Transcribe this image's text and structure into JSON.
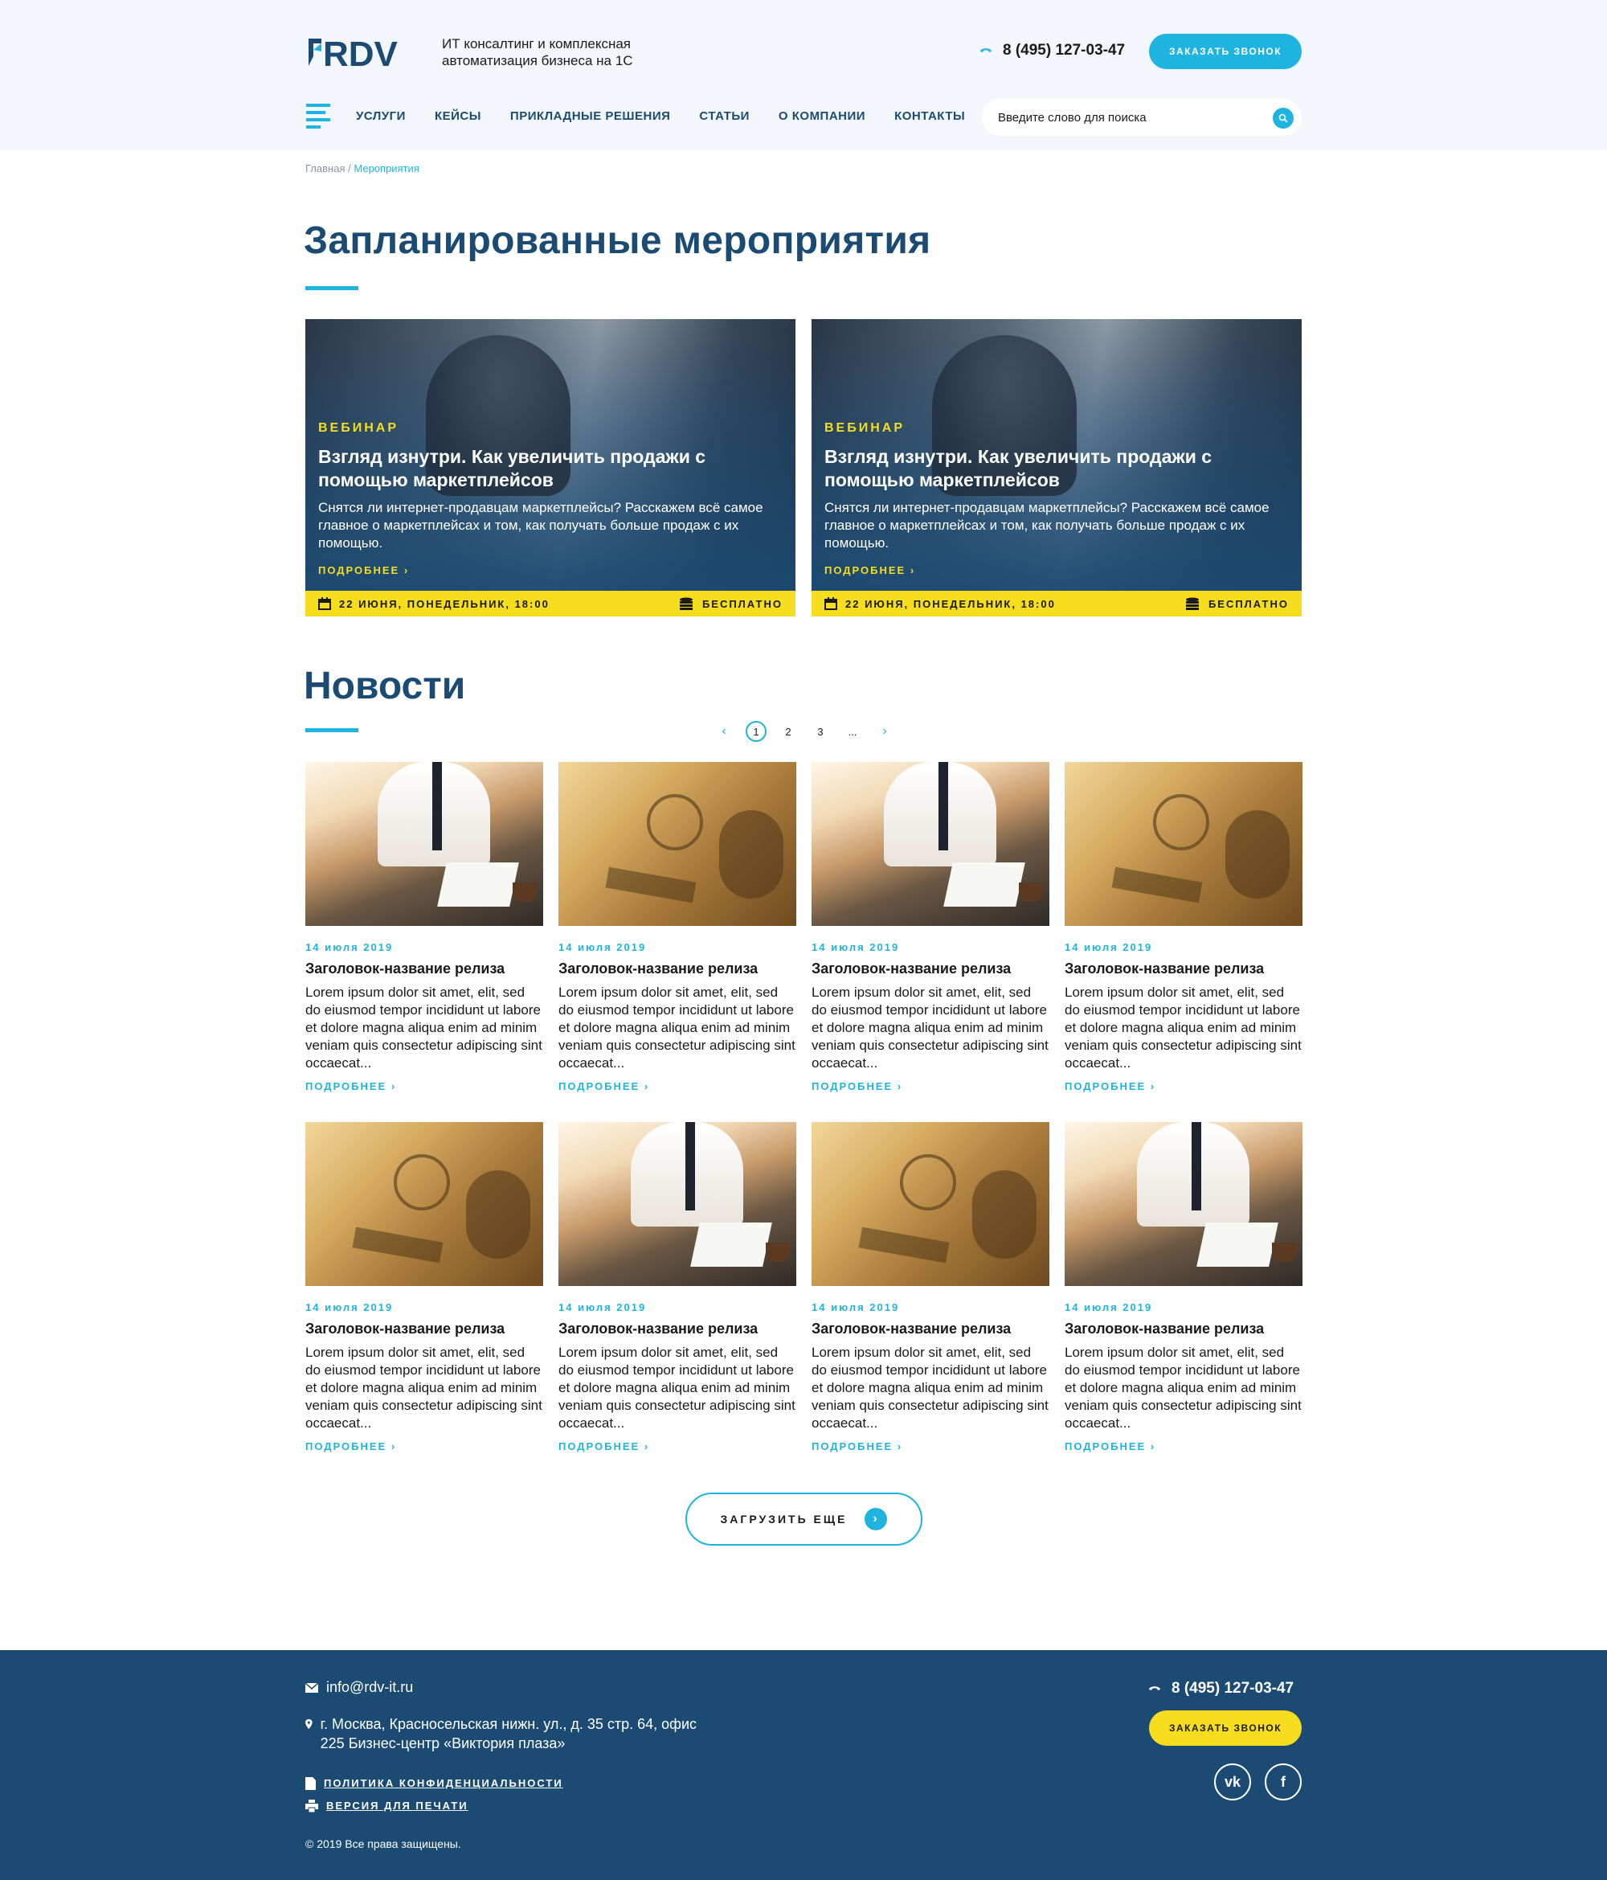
{
  "header": {
    "logo_text": "RDV",
    "tagline": "ИТ консалтинг и комплексная автоматизация бизнеса на 1С",
    "phone": "8 (495) 127-03-47",
    "callback_label": "ЗАКАЗАТЬ ЗВОНОК",
    "nav": [
      "УСЛУГИ",
      "КЕЙСЫ",
      "ПРИКЛАДНЫЕ РЕШЕНИЯ",
      "СТАТЬИ",
      "О КОМПАНИИ",
      "КОНТАКТЫ"
    ],
    "search_placeholder": "Введите слово для поиска"
  },
  "breadcrumb": {
    "home": "Главная",
    "separator": "/",
    "current": "Мероприятия"
  },
  "events": {
    "title": "Запланированные мероприятия",
    "items": [
      {
        "tag": "ВЕБИНАР",
        "title": "Взгляд изнутри. Как увеличить продажи с помощью маркетплейсов",
        "description": "Снятся ли интернет-продавцам маркетплейсы? Расскажем всё самое главное о маркетплейсах и том, как получать больше продаж с их помощью.",
        "more": "ПОДРОБНЕЕ ›",
        "date": "22 ИЮНЯ, ПОНЕДЕЛЬНИК, 18:00",
        "price": "БЕСПЛАТНО"
      },
      {
        "tag": "ВЕБИНАР",
        "title": "Взгляд изнутри. Как увеличить продажи с помощью маркетплейсов",
        "description": "Снятся ли интернет-продавцам маркетплейсы? Расскажем всё самое главное о маркетплейсах и том, как получать больше продаж с их помощью.",
        "more": "ПОДРОБНЕЕ ›",
        "date": "22 ИЮНЯ, ПОНЕДЕЛЬНИК, 18:00",
        "price": "БЕСПЛАТНО"
      }
    ]
  },
  "news": {
    "title": "Новости",
    "pagination": {
      "prev": "‹",
      "pages": [
        "1",
        "2",
        "3",
        "..."
      ],
      "active": "1",
      "next": "›"
    },
    "items": [
      {
        "image": "man",
        "date": "14 июля 2019",
        "title": "Заголовок-название релиза",
        "text": "Lorem ipsum dolor sit amet, elit, sed do eiusmod tempor incididunt ut labore et dolore magna aliqua enim ad minim veniam quis consectetur adipiscing sint occaecat...",
        "more": "ПОДРОБНЕЕ ›"
      },
      {
        "image": "money",
        "date": "14 июля 2019",
        "title": "Заголовок-название релиза",
        "text": "Lorem ipsum dolor sit amet, elit, sed do eiusmod tempor incididunt ut labore et dolore magna aliqua enim ad minim veniam quis consectetur adipiscing sint occaecat...",
        "more": "ПОДРОБНЕЕ ›"
      },
      {
        "image": "man",
        "date": "14 июля 2019",
        "title": "Заголовок-название релиза",
        "text": "Lorem ipsum dolor sit amet, elit, sed do eiusmod tempor incididunt ut labore et dolore magna aliqua enim ad minim veniam quis consectetur adipiscing sint occaecat...",
        "more": "ПОДРОБНЕЕ ›"
      },
      {
        "image": "money",
        "date": "14 июля 2019",
        "title": "Заголовок-название релиза",
        "text": "Lorem ipsum dolor sit amet, elit, sed do eiusmod tempor incididunt ut labore et dolore magna aliqua enim ad minim veniam quis consectetur adipiscing sint occaecat...",
        "more": "ПОДРОБНЕЕ ›"
      },
      {
        "image": "money",
        "date": "14 июля 2019",
        "title": "Заголовок-название релиза",
        "text": "Lorem ipsum dolor sit amet, elit, sed do eiusmod tempor incididunt ut labore et dolore magna aliqua enim ad minim veniam quis consectetur adipiscing sint occaecat...",
        "more": "ПОДРОБНЕЕ ›"
      },
      {
        "image": "man",
        "date": "14 июля 2019",
        "title": "Заголовок-название релиза",
        "text": "Lorem ipsum dolor sit amet, elit, sed do eiusmod tempor incididunt ut labore et dolore magna aliqua enim ad minim veniam quis consectetur adipiscing sint occaecat...",
        "more": "ПОДРОБНЕЕ ›"
      },
      {
        "image": "money",
        "date": "14 июля 2019",
        "title": "Заголовок-название релиза",
        "text": "Lorem ipsum dolor sit amet, elit, sed do eiusmod tempor incididunt ut labore et dolore magna aliqua enim ad minim veniam quis consectetur adipiscing sint occaecat...",
        "more": "ПОДРОБНЕЕ ›"
      },
      {
        "image": "man",
        "date": "14 июля 2019",
        "title": "Заголовок-название релиза",
        "text": "Lorem ipsum dolor sit amet, elit, sed do eiusmod tempor incididunt ut labore et dolore magna aliqua enim ad minim veniam quis consectetur adipiscing sint occaecat...",
        "more": "ПОДРОБНЕЕ ›"
      }
    ],
    "load_more": "ЗАГРУЗИТЬ ЕЩЕ"
  },
  "footer": {
    "email": "info@rdv-it.ru",
    "address": "г. Москва, Красносельская нижн. ул., д. 35 стр. 64, офис 225  Бизнес-центр «Виктория плаза»",
    "policy": "ПОЛИТИКА КОНФИДЕНЦИАЛЬНОСТИ",
    "print": "ВЕРСИЯ ДЛЯ ПЕЧАТИ",
    "copyright": "© 2019 Все права защищены.",
    "phone": "8 (495) 127-03-47",
    "callback_label": "ЗАКАЗАТЬ ЗВОНОК",
    "social": [
      "vk",
      "f"
    ]
  },
  "colors": {
    "accent": "#1fb4e0",
    "brand": "#1b4a73",
    "highlight": "#f6dd1e",
    "header_bg": "#f3f6fa"
  }
}
